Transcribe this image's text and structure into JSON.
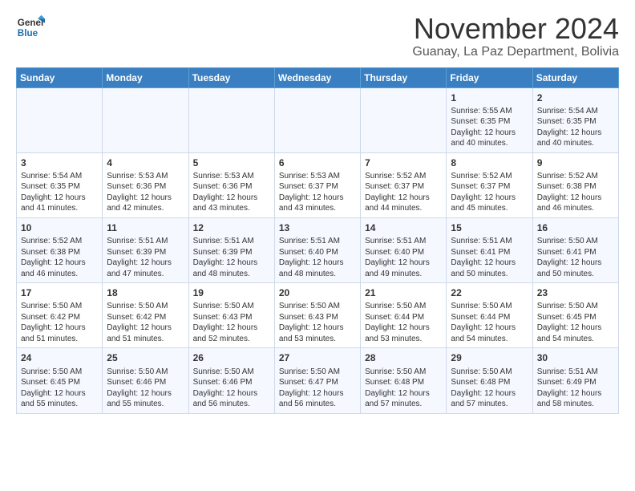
{
  "logo": {
    "line1": "General",
    "line2": "Blue"
  },
  "title": "November 2024",
  "subtitle": "Guanay, La Paz Department, Bolivia",
  "days_of_week": [
    "Sunday",
    "Monday",
    "Tuesday",
    "Wednesday",
    "Thursday",
    "Friday",
    "Saturday"
  ],
  "weeks": [
    [
      {
        "day": "",
        "info": ""
      },
      {
        "day": "",
        "info": ""
      },
      {
        "day": "",
        "info": ""
      },
      {
        "day": "",
        "info": ""
      },
      {
        "day": "",
        "info": ""
      },
      {
        "day": "1",
        "info": "Sunrise: 5:55 AM\nSunset: 6:35 PM\nDaylight: 12 hours\nand 40 minutes."
      },
      {
        "day": "2",
        "info": "Sunrise: 5:54 AM\nSunset: 6:35 PM\nDaylight: 12 hours\nand 40 minutes."
      }
    ],
    [
      {
        "day": "3",
        "info": "Sunrise: 5:54 AM\nSunset: 6:35 PM\nDaylight: 12 hours\nand 41 minutes."
      },
      {
        "day": "4",
        "info": "Sunrise: 5:53 AM\nSunset: 6:36 PM\nDaylight: 12 hours\nand 42 minutes."
      },
      {
        "day": "5",
        "info": "Sunrise: 5:53 AM\nSunset: 6:36 PM\nDaylight: 12 hours\nand 43 minutes."
      },
      {
        "day": "6",
        "info": "Sunrise: 5:53 AM\nSunset: 6:37 PM\nDaylight: 12 hours\nand 43 minutes."
      },
      {
        "day": "7",
        "info": "Sunrise: 5:52 AM\nSunset: 6:37 PM\nDaylight: 12 hours\nand 44 minutes."
      },
      {
        "day": "8",
        "info": "Sunrise: 5:52 AM\nSunset: 6:37 PM\nDaylight: 12 hours\nand 45 minutes."
      },
      {
        "day": "9",
        "info": "Sunrise: 5:52 AM\nSunset: 6:38 PM\nDaylight: 12 hours\nand 46 minutes."
      }
    ],
    [
      {
        "day": "10",
        "info": "Sunrise: 5:52 AM\nSunset: 6:38 PM\nDaylight: 12 hours\nand 46 minutes."
      },
      {
        "day": "11",
        "info": "Sunrise: 5:51 AM\nSunset: 6:39 PM\nDaylight: 12 hours\nand 47 minutes."
      },
      {
        "day": "12",
        "info": "Sunrise: 5:51 AM\nSunset: 6:39 PM\nDaylight: 12 hours\nand 48 minutes."
      },
      {
        "day": "13",
        "info": "Sunrise: 5:51 AM\nSunset: 6:40 PM\nDaylight: 12 hours\nand 48 minutes."
      },
      {
        "day": "14",
        "info": "Sunrise: 5:51 AM\nSunset: 6:40 PM\nDaylight: 12 hours\nand 49 minutes."
      },
      {
        "day": "15",
        "info": "Sunrise: 5:51 AM\nSunset: 6:41 PM\nDaylight: 12 hours\nand 50 minutes."
      },
      {
        "day": "16",
        "info": "Sunrise: 5:50 AM\nSunset: 6:41 PM\nDaylight: 12 hours\nand 50 minutes."
      }
    ],
    [
      {
        "day": "17",
        "info": "Sunrise: 5:50 AM\nSunset: 6:42 PM\nDaylight: 12 hours\nand 51 minutes."
      },
      {
        "day": "18",
        "info": "Sunrise: 5:50 AM\nSunset: 6:42 PM\nDaylight: 12 hours\nand 51 minutes."
      },
      {
        "day": "19",
        "info": "Sunrise: 5:50 AM\nSunset: 6:43 PM\nDaylight: 12 hours\nand 52 minutes."
      },
      {
        "day": "20",
        "info": "Sunrise: 5:50 AM\nSunset: 6:43 PM\nDaylight: 12 hours\nand 53 minutes."
      },
      {
        "day": "21",
        "info": "Sunrise: 5:50 AM\nSunset: 6:44 PM\nDaylight: 12 hours\nand 53 minutes."
      },
      {
        "day": "22",
        "info": "Sunrise: 5:50 AM\nSunset: 6:44 PM\nDaylight: 12 hours\nand 54 minutes."
      },
      {
        "day": "23",
        "info": "Sunrise: 5:50 AM\nSunset: 6:45 PM\nDaylight: 12 hours\nand 54 minutes."
      }
    ],
    [
      {
        "day": "24",
        "info": "Sunrise: 5:50 AM\nSunset: 6:45 PM\nDaylight: 12 hours\nand 55 minutes."
      },
      {
        "day": "25",
        "info": "Sunrise: 5:50 AM\nSunset: 6:46 PM\nDaylight: 12 hours\nand 55 minutes."
      },
      {
        "day": "26",
        "info": "Sunrise: 5:50 AM\nSunset: 6:46 PM\nDaylight: 12 hours\nand 56 minutes."
      },
      {
        "day": "27",
        "info": "Sunrise: 5:50 AM\nSunset: 6:47 PM\nDaylight: 12 hours\nand 56 minutes."
      },
      {
        "day": "28",
        "info": "Sunrise: 5:50 AM\nSunset: 6:48 PM\nDaylight: 12 hours\nand 57 minutes."
      },
      {
        "day": "29",
        "info": "Sunrise: 5:50 AM\nSunset: 6:48 PM\nDaylight: 12 hours\nand 57 minutes."
      },
      {
        "day": "30",
        "info": "Sunrise: 5:51 AM\nSunset: 6:49 PM\nDaylight: 12 hours\nand 58 minutes."
      }
    ]
  ]
}
